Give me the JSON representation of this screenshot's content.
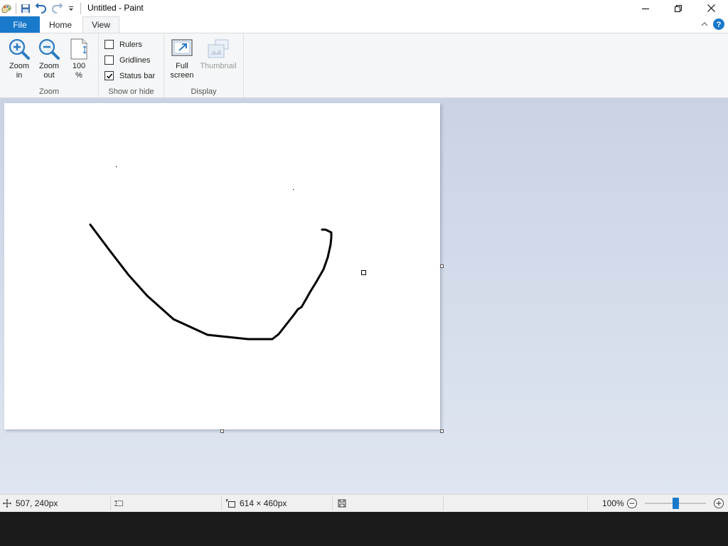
{
  "window": {
    "title": "Untitled - Paint"
  },
  "quick_access": {
    "icons": [
      "paint-app-icon",
      "save-icon",
      "undo-icon",
      "redo-icon",
      "customize-dropdown-icon"
    ]
  },
  "tabs": {
    "file": "File",
    "home": "Home",
    "view": "View"
  },
  "ribbon": {
    "zoom_group": {
      "label": "Zoom",
      "zoom_in": [
        "Zoom",
        "in"
      ],
      "zoom_out": [
        "Zoom",
        "out"
      ],
      "hundred": [
        "100",
        "%"
      ]
    },
    "show_hide_group": {
      "label": "Show or hide",
      "rulers": {
        "label": "Rulers",
        "checked": false
      },
      "gridlines": {
        "label": "Gridlines",
        "checked": false
      },
      "status_bar": {
        "label": "Status bar",
        "checked": true
      }
    },
    "display_group": {
      "label": "Display",
      "full_screen": [
        "Full",
        "screen"
      ],
      "thumbnail": "Thumbnail"
    }
  },
  "status": {
    "cursor_position": "507, 240px",
    "selection_size": "",
    "image_size": "614 × 460px",
    "zoom_level": "100%",
    "zoom_value_percent": 100
  },
  "colors": {
    "accent": "#1979ca",
    "workspace_top": "#c9d3e4",
    "workspace_bottom": "#dfe6f1"
  }
}
